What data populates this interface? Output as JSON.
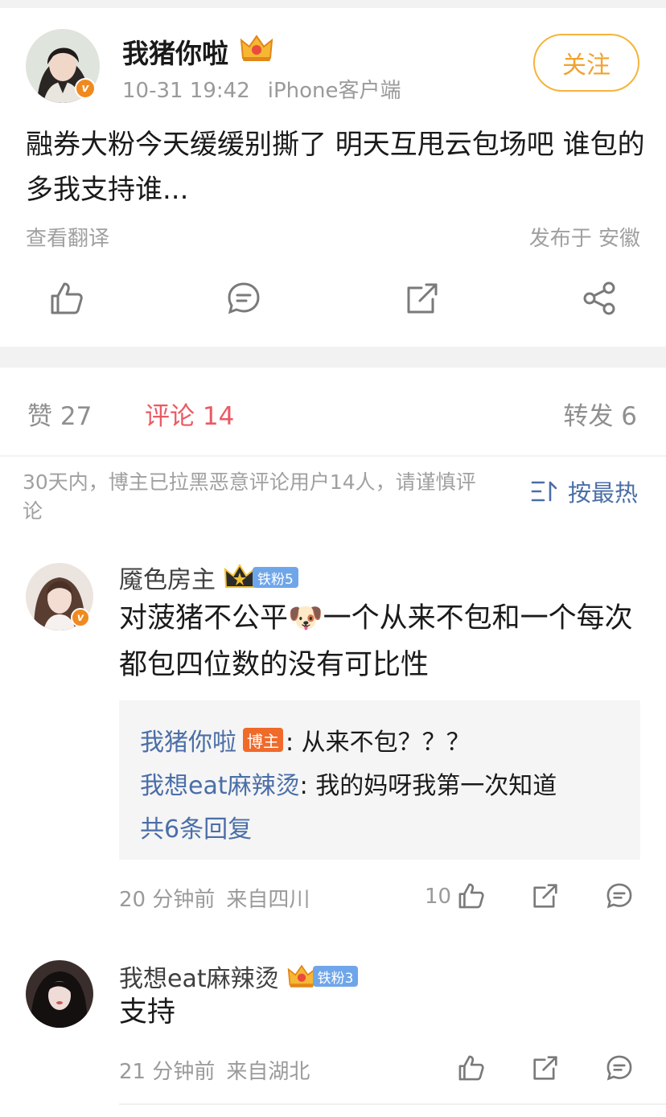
{
  "post": {
    "author": "我猪你啦",
    "time": "10-31 19:42",
    "client": "iPhone客户端",
    "follow_label": "关注",
    "text": "融券大粉今天缓缓别撕了 明天互甩云包场吧 谁包的多我支持谁...",
    "translate_label": "查看翻译",
    "location_label": "发布于 安徽"
  },
  "tabs": {
    "likes": "赞 27",
    "comments": "评论 14",
    "reposts": "转发 6"
  },
  "notice": "30天内，博主已拉黑恶意评论用户14人，请谨慎评论",
  "sort_label": "按最热",
  "comments": [
    {
      "name": "魇色房主",
      "fan_badge": "铁粉5",
      "text": "对菠猪不公平🐶一个从来不包和一个每次都包四位数的没有可比性",
      "replies": [
        {
          "name": "我猪你啦",
          "badge": "博主",
          "text": ": 从来不包？？？"
        },
        {
          "name": "我想eat麻辣烫",
          "text": " : 我的妈呀我第一次知道"
        }
      ],
      "more_replies": "共6条回复",
      "time": "20 分钟前",
      "location": "来自四川",
      "likes": "10"
    },
    {
      "name": "我想eat麻辣烫",
      "fan_badge": "铁粉3",
      "text": "支持",
      "time": "21 分钟前",
      "location": "来自湖北"
    }
  ],
  "colors": {
    "accent": "#ea5a64",
    "link": "#4a6ea8",
    "follow": "#f2a22e",
    "verified": "#f08a1f"
  }
}
